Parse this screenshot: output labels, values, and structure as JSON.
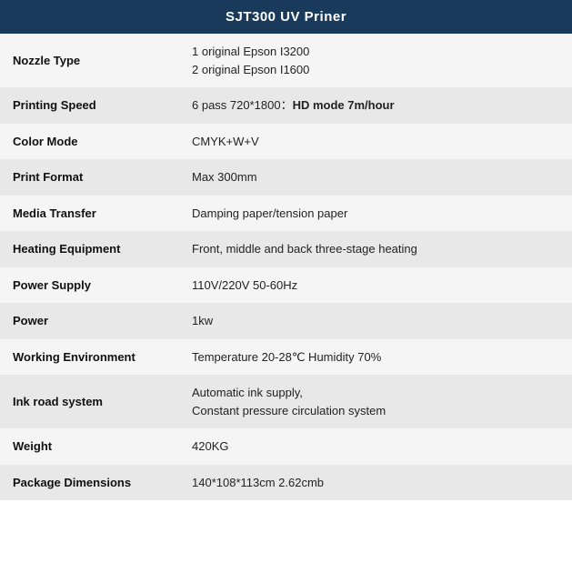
{
  "header": {
    "title": "SJT300 UV Priner"
  },
  "rows": [
    {
      "label": "Nozzle Type",
      "value": "1 original Epson I3200\n2 original Epson I1600",
      "bold_part": null
    },
    {
      "label": "Printing Speed",
      "value_prefix": "6 pass 720*1800：",
      "value_bold": "HD mode 7m/hour",
      "value": null
    },
    {
      "label": "Color Mode",
      "value": "CMYK+W+V",
      "bold_part": null
    },
    {
      "label": "Print Format",
      "value": "Max 300mm",
      "bold_part": null
    },
    {
      "label": "Media Transfer",
      "value": "Damping paper/tension paper",
      "bold_part": null
    },
    {
      "label": "Heating Equipment",
      "value": "Front, middle and back three-stage heating",
      "bold_part": null
    },
    {
      "label": "Power Supply",
      "value": "110V/220V 50-60Hz",
      "bold_part": null
    },
    {
      "label": "Power",
      "value": "1kw",
      "bold_part": null
    },
    {
      "label": "Working Environment",
      "value": "Temperature 20-28℃ Humidity 70%",
      "bold_part": null
    },
    {
      "label": "Ink road system",
      "value": "Automatic ink supply,\nConstant pressure circulation system",
      "bold_part": null
    },
    {
      "label": "Weight",
      "value": "420KG",
      "bold_part": null
    },
    {
      "label": "Package Dimensions",
      "value": "140*108*113cm 2.62cmb",
      "bold_part": null
    }
  ]
}
